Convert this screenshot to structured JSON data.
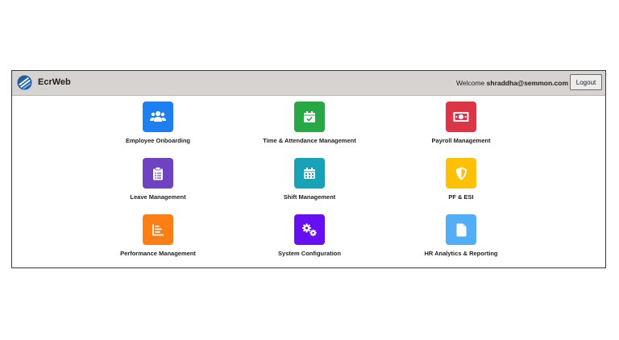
{
  "header": {
    "brand": "EcrWeb",
    "welcome_prefix": "Welcome",
    "user_email": "shraddha@semmon.com",
    "logout_label": "Logout"
  },
  "modules": [
    {
      "label": "Employee Onboarding",
      "color": "#1e7ff0",
      "icon": "users-icon"
    },
    {
      "label": "Time & Attendance Management",
      "color": "#28a745",
      "icon": "calendar-check-icon"
    },
    {
      "label": "Payroll Management",
      "color": "#dc3545",
      "icon": "money-bill-icon"
    },
    {
      "label": "Leave Management",
      "color": "#6f42c1",
      "icon": "clipboard-list-icon"
    },
    {
      "label": "Shift Management",
      "color": "#17a2b8",
      "icon": "calendar-grid-icon"
    },
    {
      "label": "PF & ESI",
      "color": "#ffc107",
      "icon": "shield-icon"
    },
    {
      "label": "Performance Management",
      "color": "#fd7e14",
      "icon": "chart-bar-icon"
    },
    {
      "label": "System Configuration",
      "color": "#6610f2",
      "icon": "cogs-icon"
    },
    {
      "label": "HR Analytics & Reporting",
      "color": "#54aef6",
      "icon": "file-icon"
    }
  ]
}
